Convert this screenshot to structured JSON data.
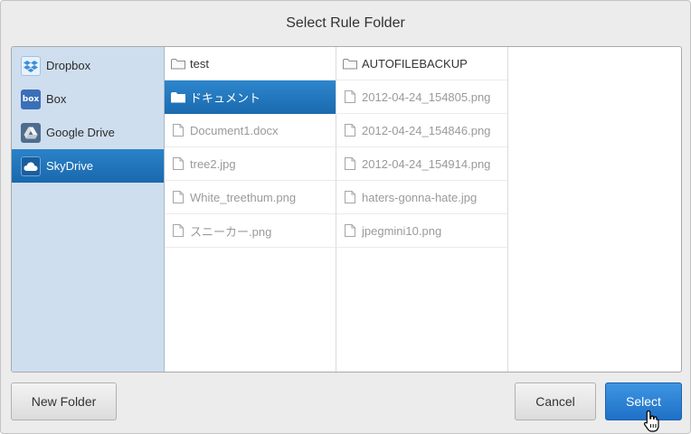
{
  "dialog": {
    "title": "Select Rule Folder"
  },
  "services": [
    {
      "label": "Dropbox",
      "icon": "dropbox-icon",
      "color": "#3d8fd6",
      "selected": false
    },
    {
      "label": "Box",
      "icon": "box-icon",
      "color": "#3b6fb8",
      "selected": false
    },
    {
      "label": "Google Drive",
      "icon": "google-drive-icon",
      "color": "#4d6d8f",
      "selected": false
    },
    {
      "label": "SkyDrive",
      "icon": "skydrive-icon",
      "color": "#1d67ad",
      "selected": true
    }
  ],
  "columns": [
    {
      "items": [
        {
          "label": "test",
          "type": "folder",
          "selected": false
        },
        {
          "label": "ドキュメント",
          "type": "folder",
          "selected": true
        },
        {
          "label": "Document1.docx",
          "type": "file",
          "selected": false
        },
        {
          "label": "tree2.jpg",
          "type": "file",
          "selected": false
        },
        {
          "label": "White_treethum.png",
          "type": "file",
          "selected": false
        },
        {
          "label": "スニーカー.png",
          "type": "file",
          "selected": false
        }
      ]
    },
    {
      "items": [
        {
          "label": "AUTOFILEBACKUP",
          "type": "folder",
          "selected": false
        },
        {
          "label": "2012-04-24_154805.png",
          "type": "file",
          "selected": false
        },
        {
          "label": "2012-04-24_154846.png",
          "type": "file",
          "selected": false
        },
        {
          "label": "2012-04-24_154914.png",
          "type": "file",
          "selected": false
        },
        {
          "label": "haters-gonna-hate.jpg",
          "type": "file",
          "selected": false
        },
        {
          "label": "jpegmini10.png",
          "type": "file",
          "selected": false
        }
      ]
    },
    {
      "items": []
    }
  ],
  "footer": {
    "new_folder_label": "New Folder",
    "cancel_label": "Cancel",
    "select_label": "Select"
  },
  "colors": {
    "accent": "#1f70c7",
    "sidebar_bg": "#cfdeee"
  }
}
